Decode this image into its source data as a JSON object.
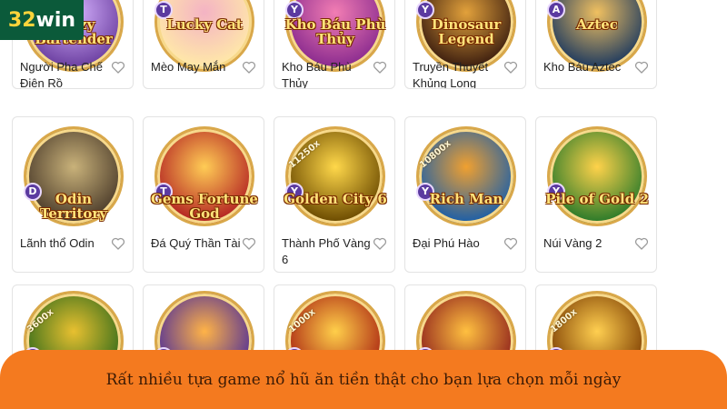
{
  "brand": {
    "number": "32",
    "word": "win"
  },
  "games": [
    {
      "name": "Người Pha Chế Điên Rồ",
      "logo": "Crazy Bartender",
      "badge": "",
      "multiplier": "",
      "colors": [
        "#6b3fa0",
        "#d7b3ff"
      ]
    },
    {
      "name": "Mèo May Mắn",
      "logo": "Lucky Cat",
      "badge": "T",
      "multiplier": "",
      "colors": [
        "#ffe9a8",
        "#f4b3c4"
      ]
    },
    {
      "name": "Kho Báu Phù Thủy",
      "logo": "Kho Báu Phù Thủy",
      "badge": "Y",
      "multiplier": "",
      "colors": [
        "#8a2b8f",
        "#f27db3"
      ]
    },
    {
      "name": "Truyền Thuyết Khủng Long",
      "logo": "Dinosaur Legend",
      "badge": "Y",
      "multiplier": "",
      "colors": [
        "#3b1d0f",
        "#e2a13b"
      ]
    },
    {
      "name": "Kho Báu Aztec",
      "logo": "Aztec",
      "badge": "A",
      "multiplier": "",
      "colors": [
        "#1e3a5f",
        "#f0c060"
      ]
    },
    {
      "name": "Lãnh thổ Odin",
      "logo": "Odin Territory",
      "badge": "D",
      "multiplier": "",
      "colors": [
        "#4b3b2a",
        "#c9b27a"
      ]
    },
    {
      "name": "Đá Quý Thần Tài",
      "logo": "Gems Fortune God",
      "badge": "T",
      "multiplier": "",
      "colors": [
        "#b32222",
        "#ffcc55"
      ]
    },
    {
      "name": "Thành Phố Vàng 6",
      "logo": "Golden City 6",
      "badge": "Y",
      "multiplier": "11250x",
      "colors": [
        "#6b4a00",
        "#ffd84a"
      ]
    },
    {
      "name": "Đại Phú Hào",
      "logo": "Rich Man",
      "badge": "Y",
      "multiplier": "10800x",
      "colors": [
        "#1c5fa8",
        "#f0a030"
      ]
    },
    {
      "name": "Núi Vàng 2",
      "logo": "Pile of Gold 2",
      "badge": "Y",
      "multiplier": "",
      "colors": [
        "#2a7a2a",
        "#ffd24a"
      ]
    },
    {
      "name": "",
      "logo": "",
      "badge": "Y",
      "multiplier": "3600x",
      "colors": [
        "#2f6a1a",
        "#e8c030"
      ]
    },
    {
      "name": "",
      "logo": "",
      "badge": "Y",
      "multiplier": "",
      "colors": [
        "#4a2a9a",
        "#ffb347"
      ]
    },
    {
      "name": "",
      "logo": "",
      "badge": "Y",
      "multiplier": "1000x",
      "colors": [
        "#a82010",
        "#ffcf4a"
      ]
    },
    {
      "name": "",
      "logo": "",
      "badge": "Y",
      "multiplier": "",
      "colors": [
        "#8a1a1a",
        "#ffc040"
      ]
    },
    {
      "name": "",
      "logo": "",
      "badge": "Y",
      "multiplier": "1800x",
      "colors": [
        "#7a3a00",
        "#ffcf50"
      ]
    }
  ],
  "banner": {
    "text": "Rất nhiều tựa game nổ hũ ăn tiền thật cho bạn lựa chọn mỗi ngày",
    "color": "#f47a1f"
  }
}
